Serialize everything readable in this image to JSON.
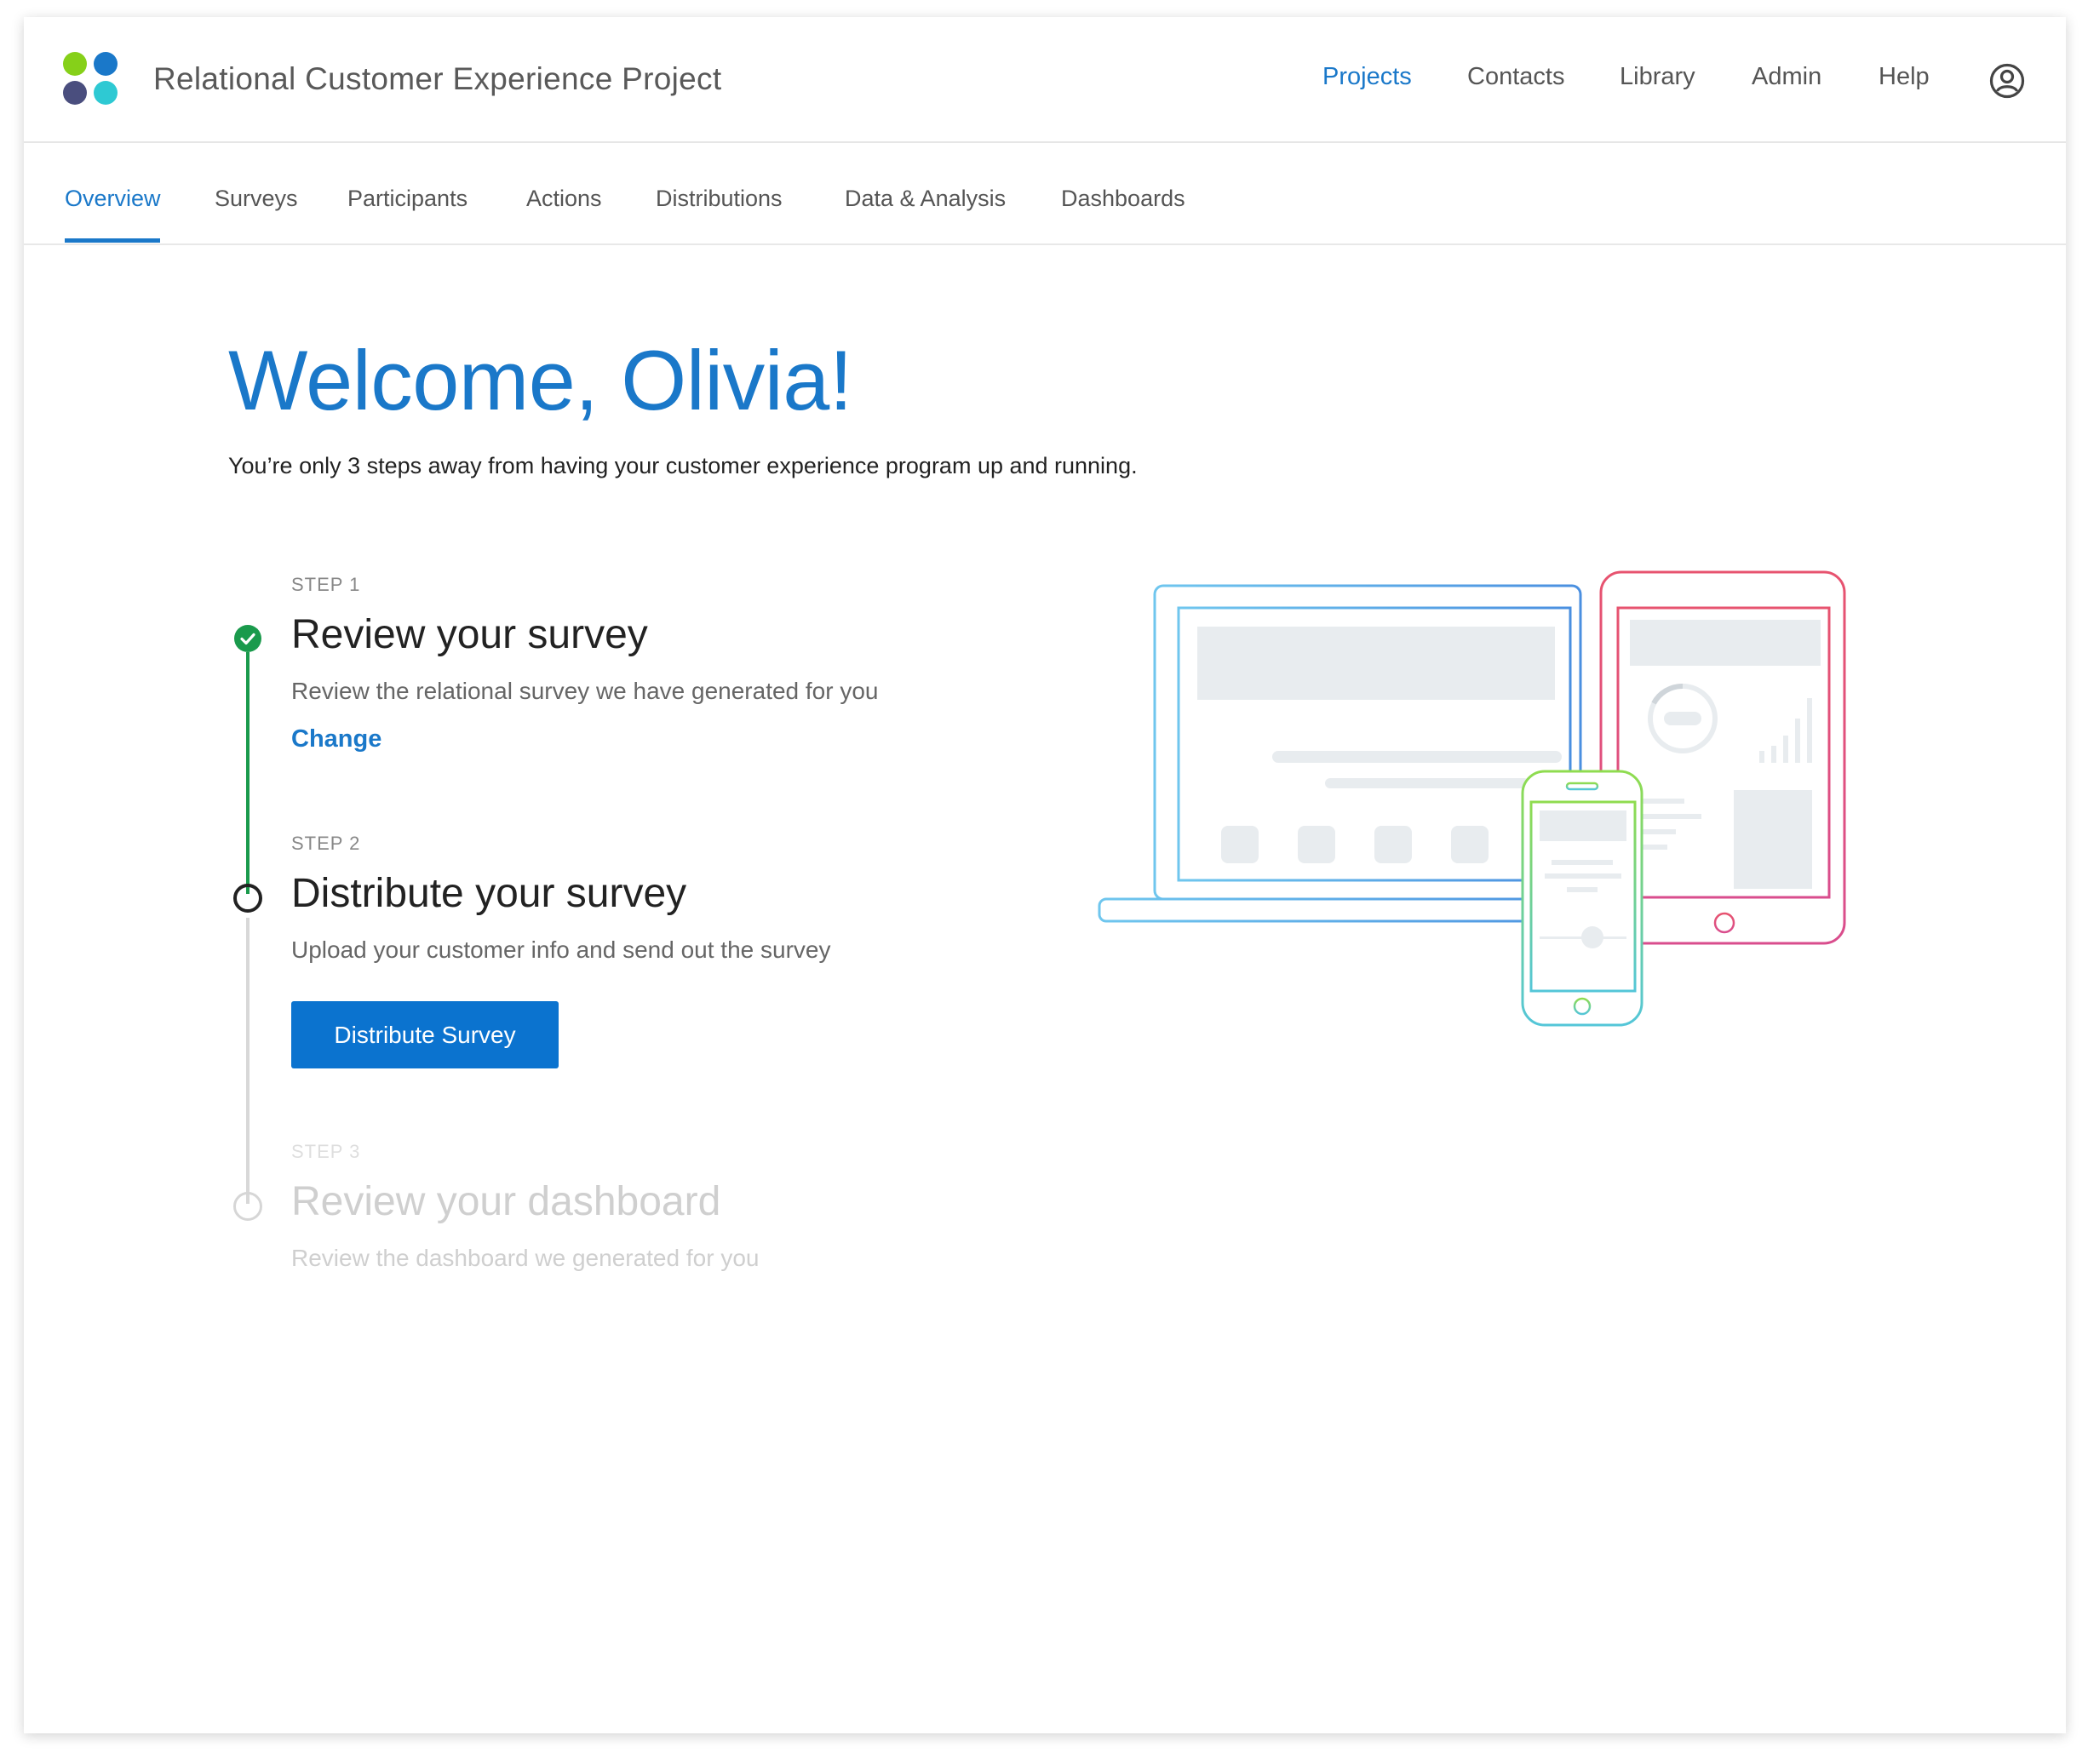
{
  "header": {
    "app_title": "Relational Customer Experience Project",
    "logo_colors": [
      "#86d019",
      "#1a78c9",
      "#4a4e7e",
      "#2ec9d3"
    ],
    "nav": [
      "Projects",
      "Contacts",
      "Library",
      "Admin",
      "Help"
    ],
    "active_nav": "Projects"
  },
  "tabs": [
    "Overview",
    "Surveys",
    "Participants",
    "Actions",
    "Distributions",
    "Data & Analysis",
    "Dashboards"
  ],
  "active_tab": "Overview",
  "welcome": {
    "title": "Welcome, Olivia!",
    "subtitle": "You’re only 3 steps away from having your customer experience program up and running."
  },
  "steps": [
    {
      "label": "STEP 1",
      "title": "Review your survey",
      "description": "Review the relational survey we have generated for you",
      "action_link": "Change",
      "status": "complete"
    },
    {
      "label": "STEP 2",
      "title": "Distribute your survey",
      "description": "Upload your customer info and send out the survey",
      "action_button": "Distribute Survey",
      "status": "current"
    },
    {
      "label": "STEP 3",
      "title": "Review your dashboard",
      "description": "Review the dashboard we generated for you",
      "status": "disabled"
    }
  ],
  "colors": {
    "accent": "#1a78c9",
    "button": "#0b73cf",
    "complete": "#1a9a4c",
    "laptop": "#6fc6ee",
    "tablet": "#e7536f",
    "phone": "#8fdc4f"
  },
  "icons": {
    "user": "user-circle-icon",
    "check": "check-icon",
    "illustration": "devices-illustration"
  }
}
